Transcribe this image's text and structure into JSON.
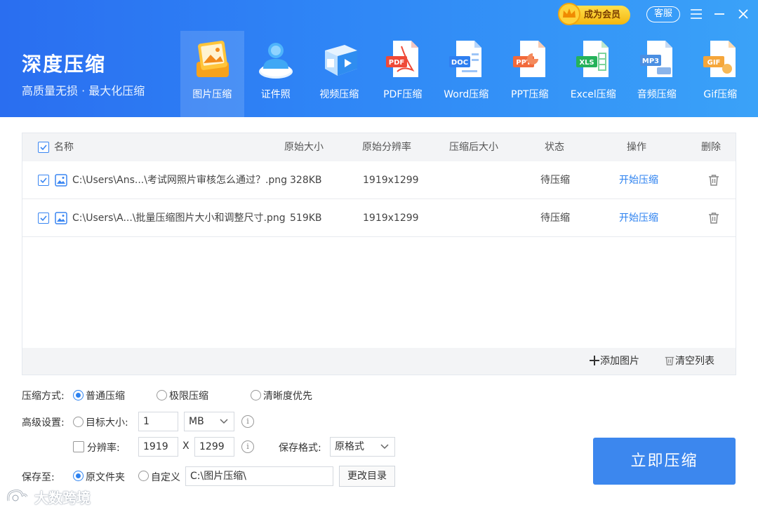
{
  "brand": {
    "title": "深度压缩",
    "subtitle": "高质量无损 · 最大化压缩"
  },
  "top": {
    "vip_label": "成为会员",
    "service_label": "客服"
  },
  "tabs": [
    {
      "label": "图片压缩",
      "icon": "image-compress-icon",
      "active": true
    },
    {
      "label": "证件照",
      "icon": "id-photo-icon"
    },
    {
      "label": "视频压缩",
      "icon": "video-compress-icon"
    },
    {
      "label": "PDF压缩",
      "icon": "pdf-icon"
    },
    {
      "label": "Word压缩",
      "icon": "doc-icon"
    },
    {
      "label": "PPT压缩",
      "icon": "ppt-icon"
    },
    {
      "label": "Excel压缩",
      "icon": "xls-icon"
    },
    {
      "label": "音频压缩",
      "icon": "mp3-icon"
    },
    {
      "label": "Gif压缩",
      "icon": "gif-icon"
    }
  ],
  "table": {
    "headers": {
      "name": "名称",
      "size": "原始大小",
      "resolution": "原始分辨率",
      "compressed": "压缩后大小",
      "status": "状态",
      "action": "操作",
      "delete": "删除"
    },
    "rows": [
      {
        "name": "C:\\Users\\Ans...\\考试网照片审核怎么通过？.png",
        "size": "328KB",
        "resolution": "1919x1299",
        "compressed": "",
        "status": "待压缩",
        "action": "开始压缩"
      },
      {
        "name": "C:\\Users\\A...\\批量压缩图片大小和调整尺寸.png",
        "size": "519KB",
        "resolution": "1919x1299",
        "compressed": "",
        "status": "待压缩",
        "action": "开始压缩"
      }
    ],
    "footer": {
      "add_label": "添加图片",
      "clear_label": "清空列表"
    }
  },
  "settings": {
    "mode_label": "压缩方式:",
    "modes": [
      "普通压缩",
      "极限压缩",
      "清晰度优先"
    ],
    "advanced_label": "高级设置:",
    "target_size_label": "目标大小:",
    "target_size_value": "1",
    "target_unit": "MB",
    "resolution_label": "分辨率:",
    "width": "1919",
    "x_sep": "X",
    "height": "1299",
    "format_label": "保存格式:",
    "format_value": "原格式",
    "save_to_label": "保存至:",
    "save_options": [
      "原文件夹",
      "自定义"
    ],
    "path": "C:\\图片压缩\\",
    "change_dir_label": "更改目录"
  },
  "compress_button": "立即压缩",
  "watermark": "大数跨境",
  "colors": {
    "accent": "#2d82f0",
    "header_start": "#2a6ef0",
    "header_end": "#3aa2f8",
    "button": "#3c87ee",
    "vip": "#f4b60f"
  }
}
